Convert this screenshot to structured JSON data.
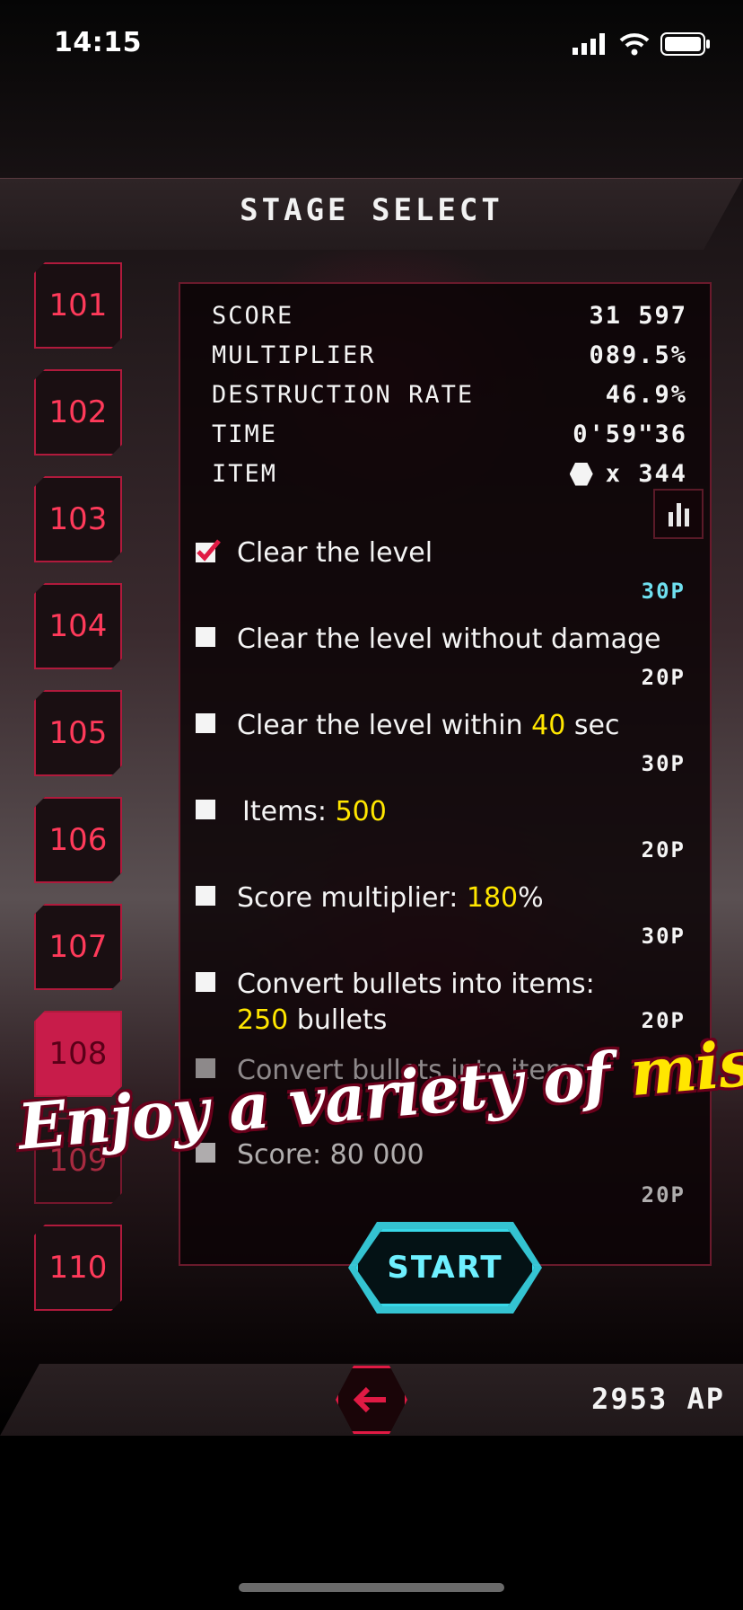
{
  "status_bar": {
    "time": "14:15"
  },
  "header": {
    "title": "STAGE SELECT"
  },
  "stages": [
    "101",
    "102",
    "103",
    "104",
    "105",
    "106",
    "107",
    "108",
    "109",
    "110"
  ],
  "selected_stage": "108",
  "stats": {
    "score_label": "SCORE",
    "score_value": "31 597",
    "multiplier_label": "MULTIPLIER",
    "multiplier_value": "089.5%",
    "destruction_label": "DESTRUCTION RATE",
    "destruction_value": "46.9%",
    "time_label": "TIME",
    "time_value": "0'59\"36",
    "item_label": "ITEM",
    "item_value": "x 344"
  },
  "missions": [
    {
      "text_before": "Clear the level",
      "highlight": "",
      "text_after": "",
      "points": "30P",
      "checked": true
    },
    {
      "text_before": "Clear the level without damage",
      "highlight": "",
      "text_after": "",
      "points": "20P",
      "checked": false
    },
    {
      "text_before": "Clear the level within ",
      "highlight": "40",
      "text_after": " sec",
      "points": "30P",
      "checked": false
    },
    {
      "text_before": "Items: ",
      "highlight": "500",
      "text_after": "",
      "points": "20P",
      "checked": false
    },
    {
      "text_before": "Score multiplier: ",
      "highlight": "180",
      "text_after": "%",
      "points": "30P",
      "checked": false
    },
    {
      "text_before": "Convert bullets into items:",
      "line2_highlight": "250",
      "line2_after": " bullets",
      "points": "20P",
      "checked": false
    },
    {
      "text_before": "Convert bullets into items:",
      "points": "",
      "checked": false
    },
    {
      "text_before": "Score: ",
      "highlight": "80 000",
      "text_after": "",
      "points": "20P",
      "checked": false
    }
  ],
  "start_button": {
    "label": "START"
  },
  "banner": {
    "part1": "Enjoy a variety of ",
    "part2": "missions",
    "part3": "!"
  },
  "footer": {
    "ap_value": "2953 AP"
  },
  "colors": {
    "accent_red": "#e01a44",
    "accent_cyan": "#38d8e8",
    "highlight_yellow": "#ffe600"
  },
  "icons": [
    "signal-icon",
    "wifi-icon",
    "battery-icon",
    "hexagon-item-icon",
    "chart-icon",
    "back-arrow-icon"
  ]
}
